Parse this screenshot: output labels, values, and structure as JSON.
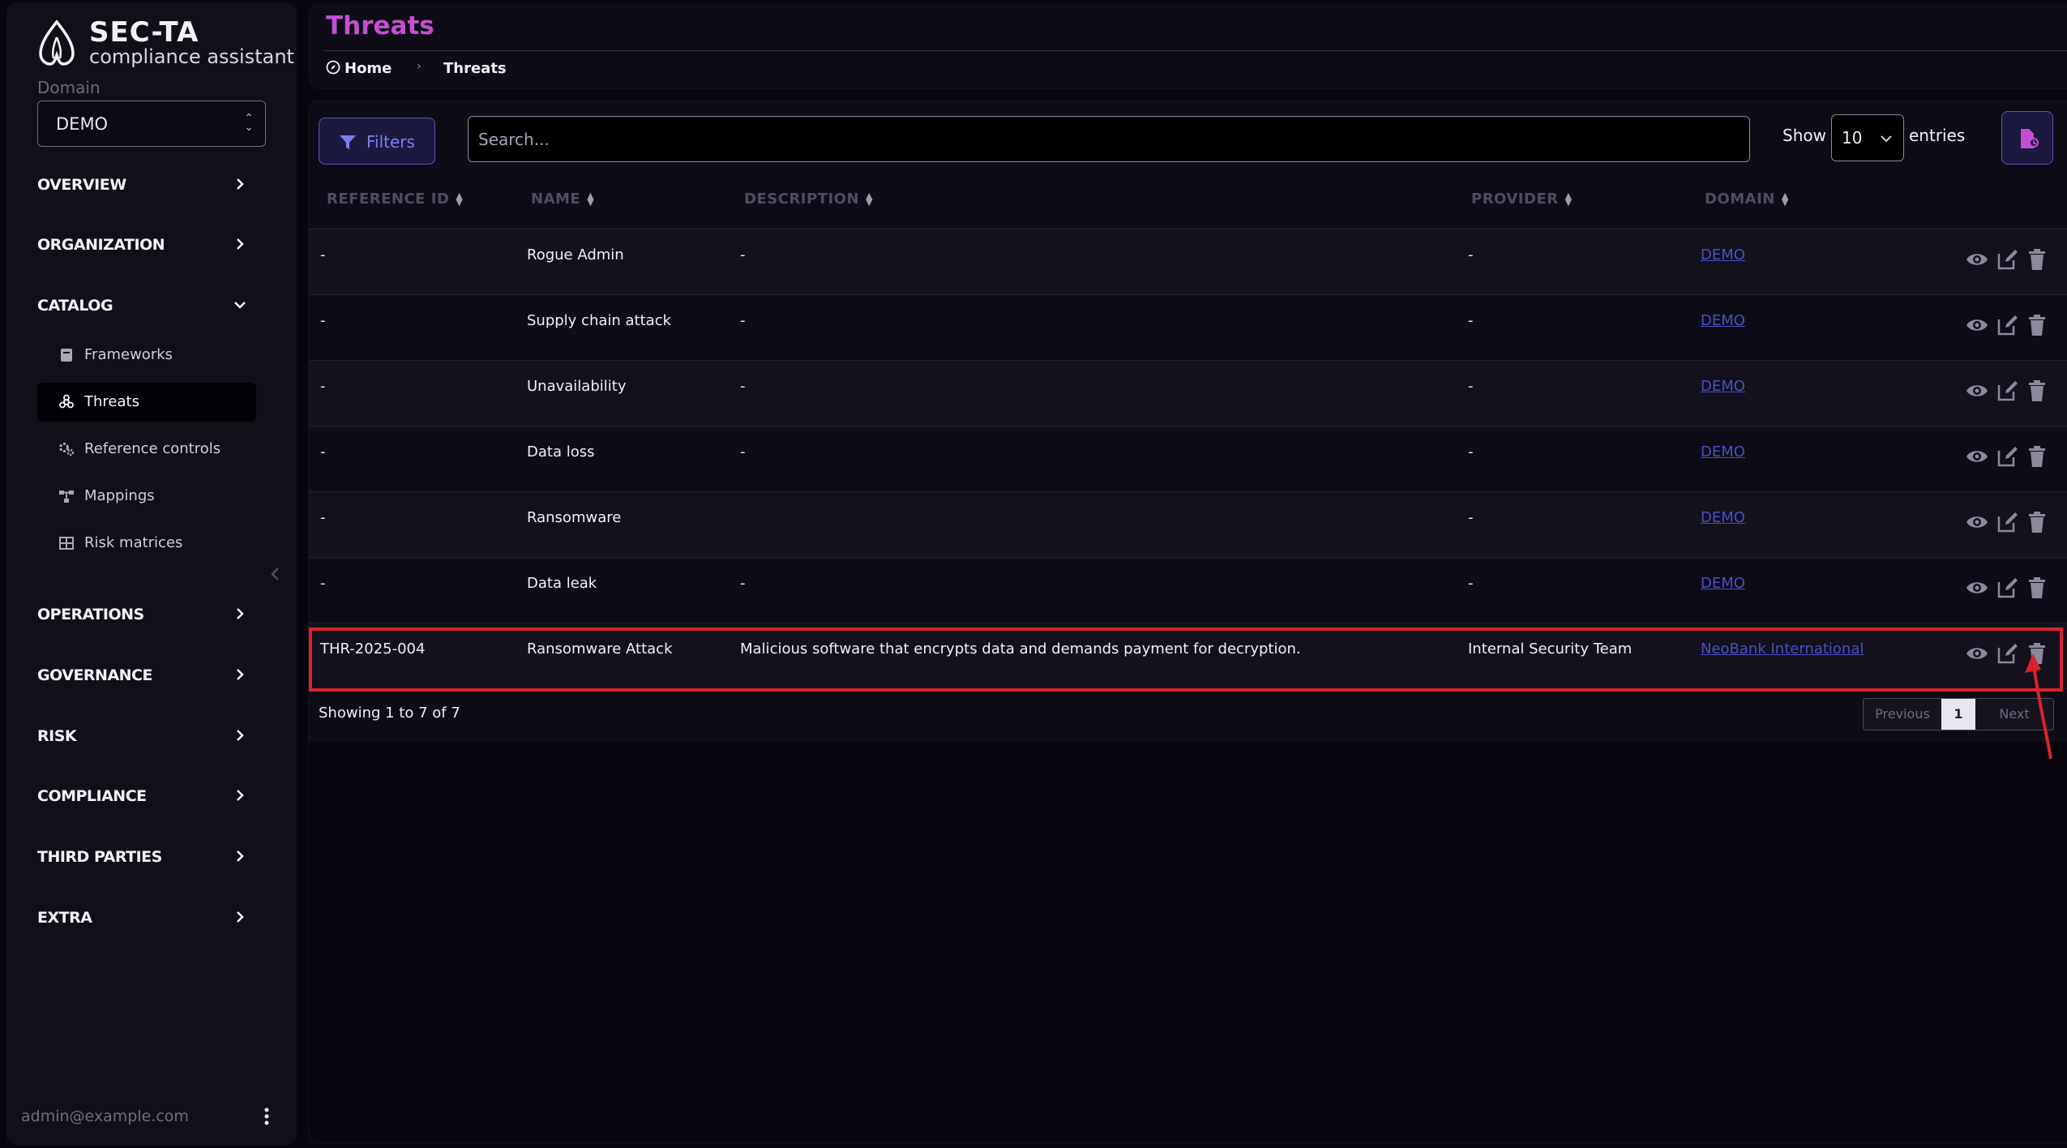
{
  "brand": {
    "name": "SEC-TA",
    "tagline": "compliance assistant"
  },
  "domain": {
    "label": "Domain",
    "value": "DEMO"
  },
  "nav": {
    "overview": "OVERVIEW",
    "organization": "ORGANIZATION",
    "catalog": "CATALOG",
    "catalog_items": {
      "frameworks": "Frameworks",
      "threats": "Threats",
      "reference_controls": "Reference controls",
      "mappings": "Mappings",
      "risk_matrices": "Risk matrices"
    },
    "operations": "OPERATIONS",
    "governance": "GOVERNANCE",
    "risk": "RISK",
    "compliance": "COMPLIANCE",
    "third_parties": "THIRD PARTIES",
    "extra": "EXTRA"
  },
  "user": {
    "email": "admin@example.com"
  },
  "header": {
    "title": "Threats",
    "breadcrumb_home": "Home",
    "breadcrumb_current": "Threats"
  },
  "toolbar": {
    "filters_label": "Filters",
    "search_placeholder": "Search...",
    "show_label": "Show",
    "entries_value": "10",
    "entries_label": "entries"
  },
  "table": {
    "columns": {
      "reference_id": "REFERENCE ID",
      "name": "NAME",
      "description": "DESCRIPTION",
      "provider": "PROVIDER",
      "domain": "DOMAIN"
    },
    "rows": [
      {
        "ref": "-",
        "name": "Rogue Admin",
        "description": "-",
        "provider": "-",
        "domain": "DEMO"
      },
      {
        "ref": "-",
        "name": "Supply chain attack",
        "description": "-",
        "provider": "-",
        "domain": "DEMO"
      },
      {
        "ref": "-",
        "name": "Unavailability",
        "description": "-",
        "provider": "-",
        "domain": "DEMO"
      },
      {
        "ref": "-",
        "name": "Data loss",
        "description": "-",
        "provider": "-",
        "domain": "DEMO"
      },
      {
        "ref": "-",
        "name": "Ransomware",
        "description": "",
        "provider": "-",
        "domain": "DEMO"
      },
      {
        "ref": "-",
        "name": "Data leak",
        "description": "-",
        "provider": "-",
        "domain": "DEMO"
      },
      {
        "ref": "THR-2025-004",
        "name": "Ransomware Attack",
        "description": "Malicious software that encrypts data and demands payment for decryption.",
        "provider": "Internal Security Team",
        "domain": "NeoBank International"
      }
    ]
  },
  "footer": {
    "showing": "Showing 1 to 7 of 7",
    "previous": "Previous",
    "page": "1",
    "next": "Next"
  },
  "colors": {
    "accent": "#c34fd2",
    "primary": "#7d7df2",
    "link": "#4b4fc8",
    "highlight": "#d9232c"
  }
}
